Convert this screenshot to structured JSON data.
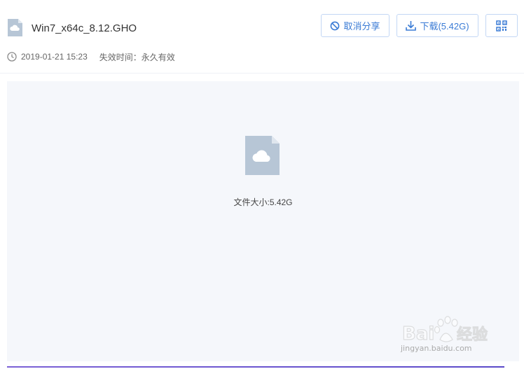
{
  "file": {
    "name": "Win7_x64c_8.12.GHO",
    "icon": "cloud-file-icon"
  },
  "actions": {
    "cancel_share": "取消分享",
    "download": "下载(5.42G)",
    "qr_icon": "qr-code-icon"
  },
  "meta": {
    "created": "2019-01-21 15:23",
    "expire_label": "失效时间：永久有效"
  },
  "preview": {
    "size_label": "文件大小:5.42G"
  },
  "watermark": {
    "brand": "Bai 经验",
    "url": "jingyan.baidu.com"
  },
  "colors": {
    "accent": "#3a7bd5",
    "button_border": "#c3d7f5",
    "file_icon": "#b7c6d6",
    "preview_bg": "#f5f7fb"
  }
}
